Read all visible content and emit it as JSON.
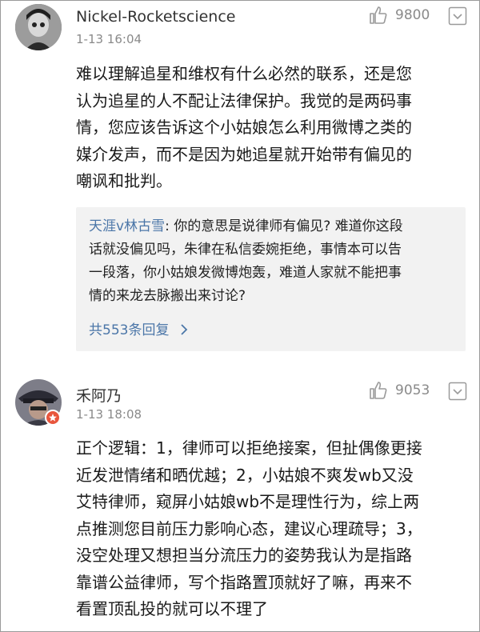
{
  "comments": [
    {
      "username": "Nickel-Rocketscience",
      "timestamp": "1-13 16:04",
      "likes": "9800",
      "body_lines": [
        "难以理解追星和维权有什么必然的联系，还是您",
        "认为追星的人不配让法律保护。我觉的是两码事",
        "情，您应该告诉这个小姑娘怎么利用微博之类的",
        "媒介发声，而不是因为她追星就开始带有偏见的",
        "嘲讽和批判。"
      ],
      "reply": {
        "user": "天涯v林古雪",
        "text_lines": [
          ": 你的意思是说律师有偏见? 难道你这段",
          "话就没偏见吗，朱律在私信委婉拒绝，事情本可以告",
          "一段落，你小姑娘发微博炮轰，难道人家就不能把事",
          "情的来龙去脉搬出来讨论?"
        ],
        "more_label": "共553条回复",
        "more_icon": "chevron-right-icon"
      }
    },
    {
      "username": "禾阿乃",
      "timestamp": "1-13 18:08",
      "likes": "9053",
      "body_lines": [
        "正个逻辑：1，律师可以拒绝接案，但扯偶像更接",
        "近发泄情绪和晒优越；2，小姑娘不爽发wb又没",
        "艾特律师，窥屏小姑娘wb不是理性行为，综上两",
        "点推测您目前压力影响心态，建议心理疏导；3，",
        "没空处理又想担当分流压力的姿势我认为是指路",
        "靠谱公益律师，写个指路置顶就好了嘛，再来不",
        "看置顶乱投的就可以不理了"
      ]
    }
  ],
  "icons": {
    "like": "thumbs-up-icon",
    "more": "chevron-down-box-icon",
    "badge": "verified-badge-icon"
  },
  "colors": {
    "link_blue": "#4b76a8",
    "muted_gray": "#8a8a8a",
    "reply_bg": "#f2f2f2",
    "badge_red": "#e8553c"
  }
}
